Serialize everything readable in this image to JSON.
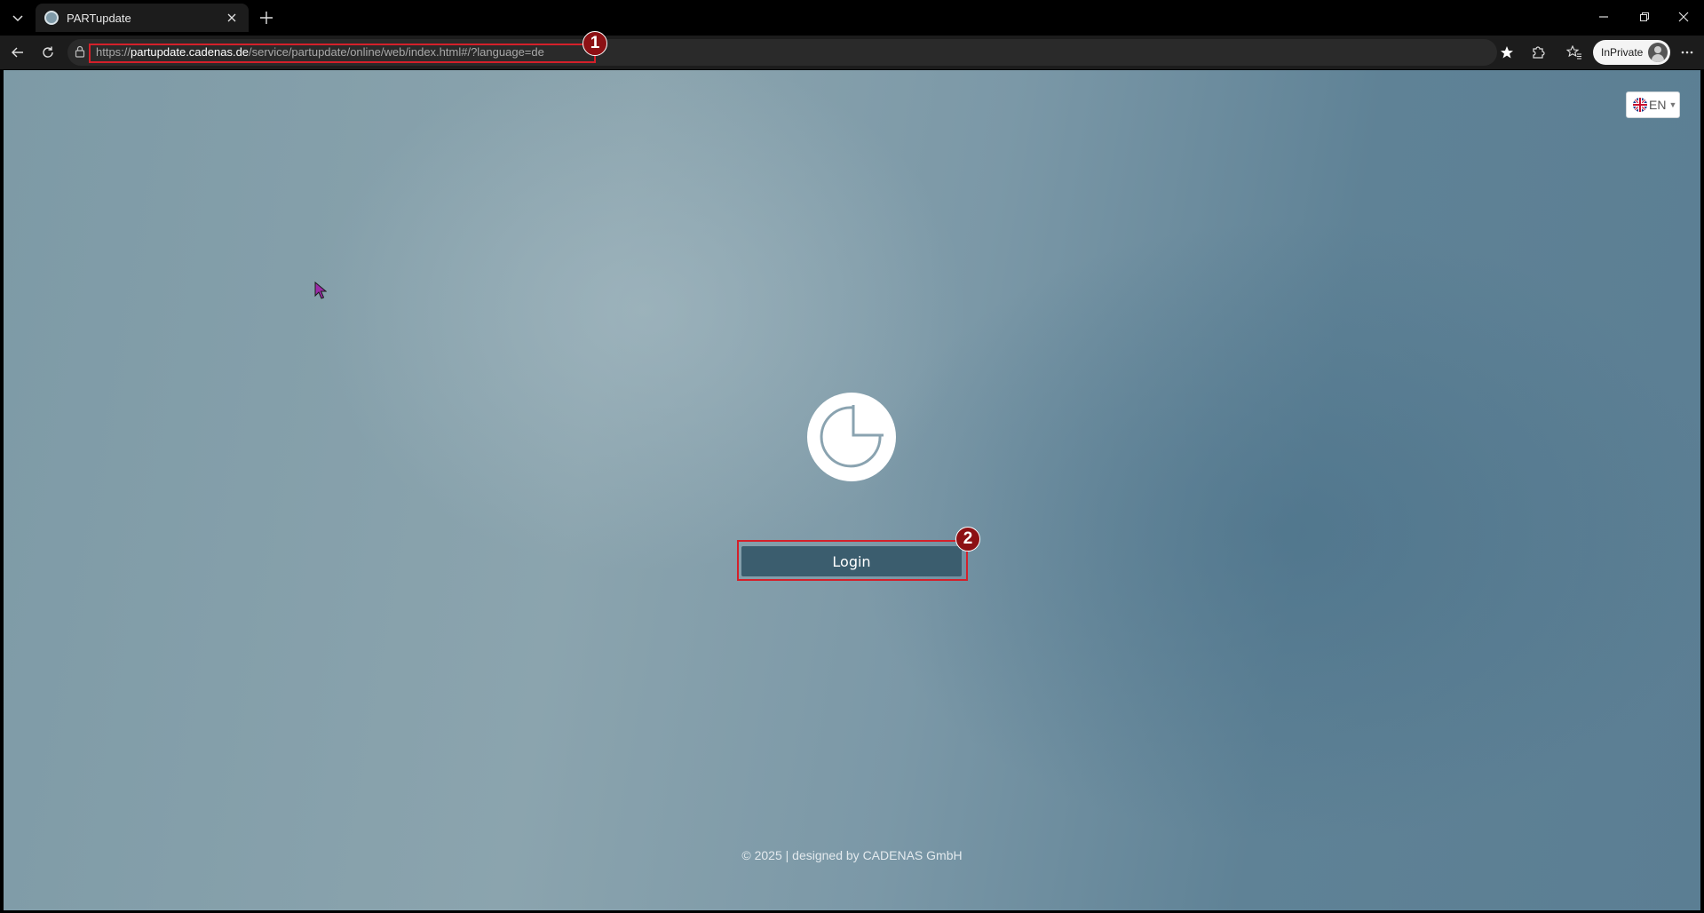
{
  "browser": {
    "tab_title": "PARTupdate",
    "url_scheme": "https://",
    "url_host": "partupdate.cadenas.de",
    "url_path": "/service/partupdate/online/web/index.html#/?language=de",
    "inprivate_label": "InPrivate"
  },
  "page": {
    "language_button": "EN",
    "login_label": "Login",
    "footer_text": "© 2025 | designed by CADENAS GmbH"
  },
  "annotations": {
    "badge_1": "1",
    "badge_2": "2"
  },
  "colors": {
    "login_button": "#3b5d6e",
    "highlight": "#d4202a",
    "badge": "#8c1014"
  }
}
